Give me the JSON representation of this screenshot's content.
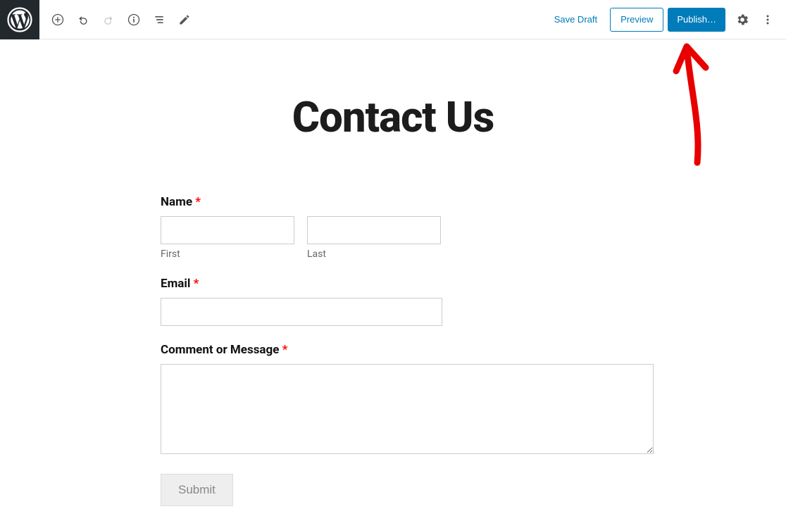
{
  "toolbar": {
    "save_draft": "Save Draft",
    "preview": "Preview",
    "publish": "Publish…"
  },
  "page": {
    "title": "Contact Us"
  },
  "form": {
    "name_label": "Name",
    "name_first_sub": "First",
    "name_last_sub": "Last",
    "email_label": "Email",
    "message_label": "Comment or Message",
    "submit_label": "Submit",
    "required_mark": "*"
  }
}
